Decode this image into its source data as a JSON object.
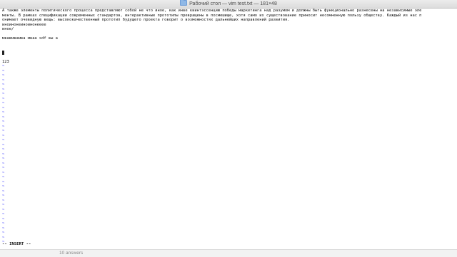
{
  "window": {
    "title": "Рабочий стол — vim test.txt — 181×48",
    "title_icon": "folder-icon"
  },
  "editor": {
    "lines": [
      "А также элементы политического процесса представляют собой не что иное, как инве квинтэссенцию победы маркетинга над разумом и должны быть функционально разнесены на независимые эле",
      "менты. В рамках спецификации современных стандартов, интерактивные прототипы превращены в посмешище, хотя само их существование приносит несомненную пользу обществу. Каждый из нас п",
      "онимает очевидную вещь: высококачественный прототип будущего проекта говорит о возможностях дальнейших направлений развития.",
      "иноинонеиноинонееее",
      "инoe/",
      "",
      "мвавмвамва мваа sdf вы а",
      "",
      "",
      "",
      "",
      "123"
    ],
    "cursor_line": 9,
    "empty_line_marker": "~",
    "empty_line_count": 39
  },
  "status": {
    "mode": "-- INSERT --"
  },
  "background_window": {
    "text": "10 answers"
  },
  "colors": {
    "tilde": "#1414ff",
    "text": "#111111"
  }
}
